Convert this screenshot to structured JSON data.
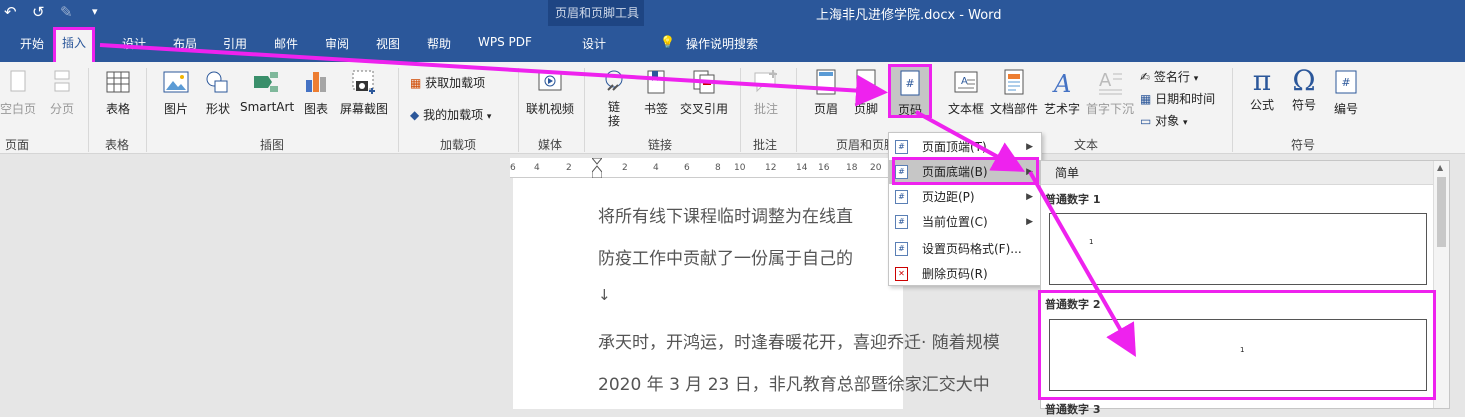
{
  "title": {
    "doc_title": "上海非凡进修学院.docx  -  Word",
    "context_tool": "页眉和页脚工具"
  },
  "quick_access": {
    "undo": "↶",
    "redo": "↺",
    "customize": "▾"
  },
  "tabs": [
    "开始",
    "插入",
    "设计",
    "布局",
    "引用",
    "邮件",
    "审阅",
    "视图",
    "帮助",
    "WPS PDF",
    "设计"
  ],
  "tell_me": "操作说明搜索",
  "ribbon": {
    "pages": {
      "blank": "空白页",
      "break": "分页",
      "group": "页面"
    },
    "table": {
      "table": "表格",
      "group": "表格"
    },
    "illustrations": {
      "picture": "图片",
      "shapes": "形状",
      "smartart": "SmartArt",
      "chart": "图表",
      "screenshot": "屏幕截图",
      "group": "插图"
    },
    "addins": {
      "get": "获取加载项",
      "mine": "我的加载项",
      "group": "加载项"
    },
    "media": {
      "online_video": "联机视频",
      "group": "媒体"
    },
    "links": {
      "link": "链接",
      "bookmark": "书签",
      "cross_ref": "交叉引用",
      "group": "链接"
    },
    "comments": {
      "comment": "批注",
      "group": "批注"
    },
    "header_footer": {
      "header": "页眉",
      "footer": "页脚",
      "page_number": "页码",
      "group": "页眉和页脚"
    },
    "text": {
      "textbox": "文本框",
      "quick_parts": "文档部件",
      "wordart": "艺术字",
      "drop_cap": "首字下沉",
      "signature": "签名行",
      "datetime": "日期和时间",
      "object": "对象",
      "group": "文本"
    },
    "symbols": {
      "equation": "公式",
      "symbol": "符号",
      "number": "编号",
      "group": "符号"
    }
  },
  "ruler_ticks": [
    "6",
    "4",
    "2",
    "2",
    "4",
    "6",
    "8",
    "10",
    "12",
    "14",
    "16",
    "18",
    "20"
  ],
  "document": {
    "paragraphs": [
      "将所有线下课程临时调整为在线直",
      "防疫工作中贡献了一份属于自己的",
      "↓",
      "承天时，开鸿运，时逢春暖花开，喜迎乔迁· 随着规模",
      "2020 年 3 月 23 日，非凡教育总部暨徐家汇交大中"
    ]
  },
  "page_number_menu": {
    "items": [
      {
        "label": "页面顶端(T)",
        "submenu": true
      },
      {
        "label": "页面底端(B)",
        "submenu": true
      },
      {
        "label": "页边距(P)",
        "submenu": true
      },
      {
        "label": "当前位置(C)",
        "submenu": true
      },
      {
        "label": "设置页码格式(F)...",
        "submenu": false
      },
      {
        "label": "删除页码(R)",
        "submenu": false
      }
    ]
  },
  "gallery": {
    "title": "简单",
    "items": [
      {
        "label": "普通数字 1",
        "number": "1"
      },
      {
        "label": "普通数字 2",
        "number": "1"
      },
      {
        "label": "普通数字 3"
      }
    ]
  },
  "colors": {
    "word_blue": "#2b579a",
    "highlight": "#ee22ee"
  }
}
